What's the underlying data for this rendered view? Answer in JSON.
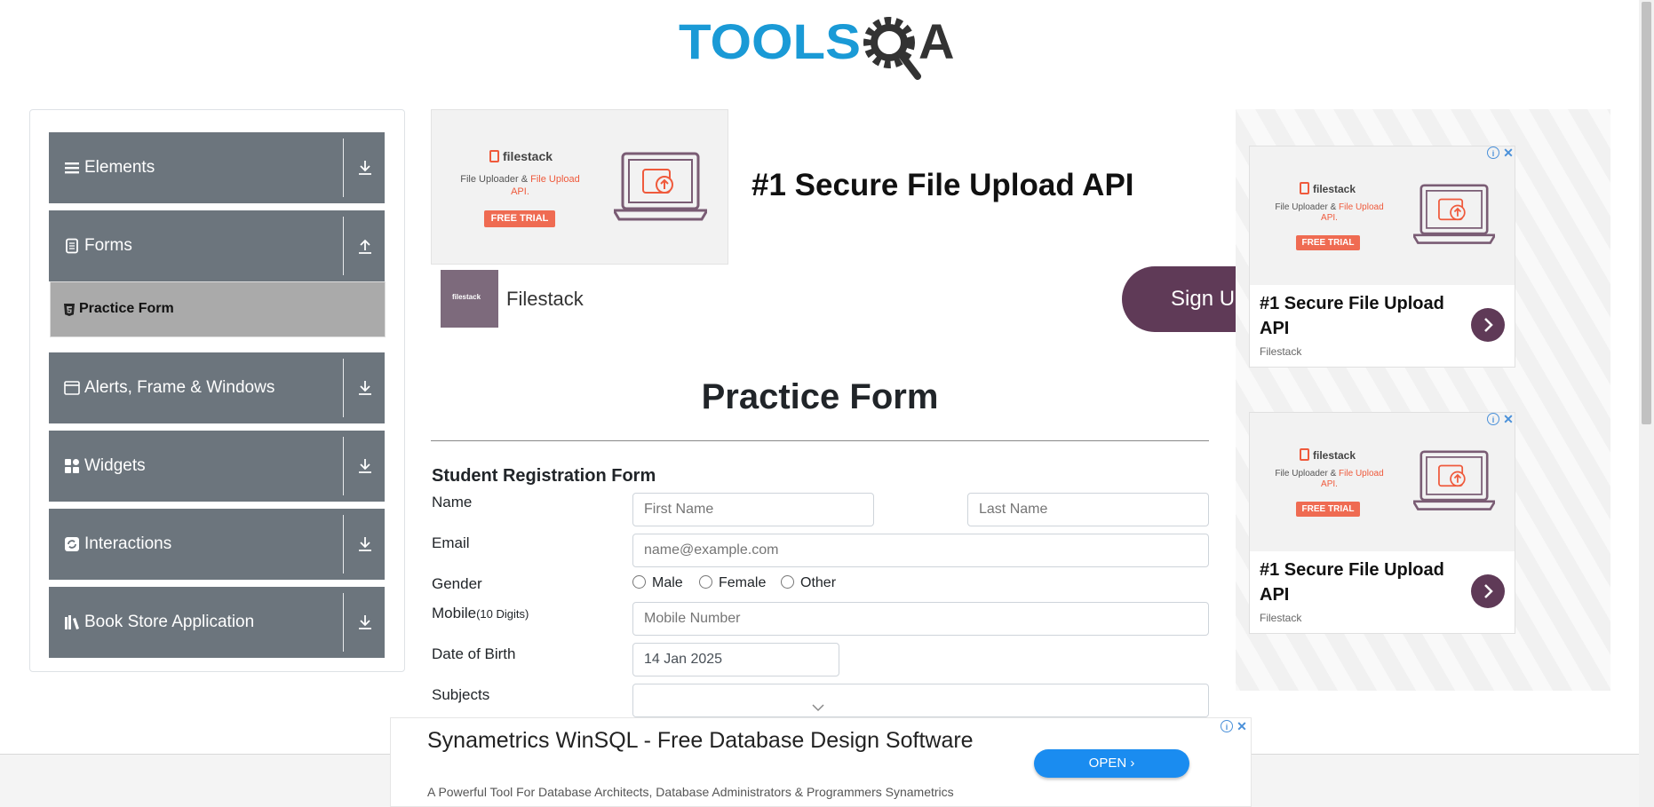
{
  "header": {
    "logo_text_left": "TOOLS",
    "logo_text_right": "A"
  },
  "sidebar": {
    "groups": [
      {
        "label": "Elements",
        "icon": "menu-lines-icon",
        "arrow": "download-arrow-icon"
      },
      {
        "label": "Forms",
        "icon": "document-icon",
        "arrow": "upload-arrow-icon"
      },
      {
        "label": "Alerts, Frame & Windows",
        "icon": "browser-window-icon",
        "arrow": "download-arrow-icon"
      },
      {
        "label": "Widgets",
        "icon": "widgets-icon",
        "arrow": "download-arrow-icon"
      },
      {
        "label": "Interactions",
        "icon": "interaction-icon",
        "arrow": "download-arrow-icon"
      },
      {
        "label": "Book Store Application",
        "icon": "books-icon",
        "arrow": "download-arrow-icon"
      }
    ],
    "active_item": {
      "label": "Practice Form",
      "icon": "html5-icon"
    }
  },
  "top_ad": {
    "creative_brand": "filestack",
    "creative_tagline_1": "File Uploader & ",
    "creative_tagline_hl": "File Upload",
    "creative_tagline_2": "API.",
    "creative_cta": "FREE TRIAL",
    "headline": "#1 Secure File Upload API",
    "brand_name": "Filestack",
    "brand_thumb_text": "filestack",
    "button": "Sign Up"
  },
  "form": {
    "page_title": "Practice Form",
    "section_title": "Student Registration Form",
    "labels": {
      "name": "Name",
      "email": "Email",
      "gender": "Gender",
      "mobile": "Mobile",
      "mobile_hint": "(10 Digits)",
      "dob": "Date of Birth",
      "subjects": "Subjects"
    },
    "placeholders": {
      "first_name": "First Name",
      "last_name": "Last Name",
      "email": "name@example.com",
      "mobile": "Mobile Number"
    },
    "gender_options": [
      "Male",
      "Female",
      "Other"
    ],
    "dob_value": "14 Jan 2025",
    "subjects_value": ""
  },
  "right_ads": [
    {
      "creative_brand": "filestack",
      "creative_tagline_1": "File Uploader & ",
      "creative_tagline_hl": "File Upload",
      "creative_tagline_2": "API.",
      "creative_cta": "FREE TRIAL",
      "headline": "#1 Secure File Upload API",
      "brand": "Filestack"
    },
    {
      "creative_brand": "filestack",
      "creative_tagline_1": "File Uploader & ",
      "creative_tagline_hl": "File Upload",
      "creative_tagline_2": "API.",
      "creative_cta": "FREE TRIAL",
      "headline": "#1 Secure File Upload API",
      "brand": "Filestack"
    }
  ],
  "bottom_ad": {
    "headline": "Synametrics WinSQL - Free Database Design Software",
    "subtext": "A Powerful Tool For Database Architects, Database Administrators & Programmers Synametrics",
    "button": "OPEN"
  },
  "colors": {
    "brand_blue": "#1a9ad6",
    "logo_dark": "#333333",
    "sidebar_group": "#6c757d",
    "sidebar_active": "#aaaaaa",
    "ad_purple": "#5f3a57",
    "ad_accent": "#ef5a3c",
    "open_button": "#1a8cf0"
  }
}
